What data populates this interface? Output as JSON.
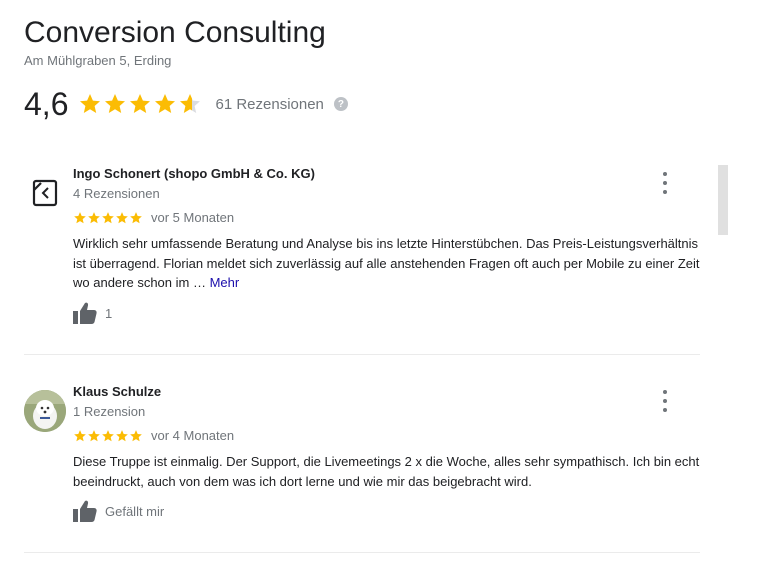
{
  "business": {
    "name": "Conversion Consulting",
    "address": "Am Mühlgraben 5, Erding",
    "rating": "4,6",
    "rating_stars_value": 4.6,
    "review_count_label": "61 Rezensionen",
    "help_label": "?"
  },
  "reviews": [
    {
      "name": "Ingo Schonert (shopo GmbH & Co. KG)",
      "count": "4 Rezensionen",
      "stars": 5,
      "date": "vor 5 Monaten",
      "text": "Wirklich sehr umfassende Beratung und Analyse bis ins letzte Hinterstübchen. Das Preis-Leistungsverhältnis ist überragend. Florian meldet sich zuverlässig auf alle anstehenden Fragen oft auch per Mobile zu einer Zeit wo andere schon im … ",
      "more_label": "Mehr",
      "like_label": "1"
    },
    {
      "name": "Klaus Schulze",
      "count": "1 Rezension",
      "stars": 5,
      "date": "vor 4 Monaten",
      "text": "Diese Truppe ist einmalig. Der Support, die Livemeetings 2 x die Woche, alles sehr sympathisch. Ich bin echt beeindruckt, auch von dem was ich dort lerne und wie mir das beigebracht wird.",
      "like_label": "Gefällt mir"
    }
  ],
  "colors": {
    "star": "#fbbc04",
    "star_empty": "#dadce0",
    "link": "#1a0dab"
  },
  "icons": {
    "star": "star-icon",
    "help": "help-icon",
    "more": "more-vert-icon",
    "like": "thumbs-up-icon"
  }
}
